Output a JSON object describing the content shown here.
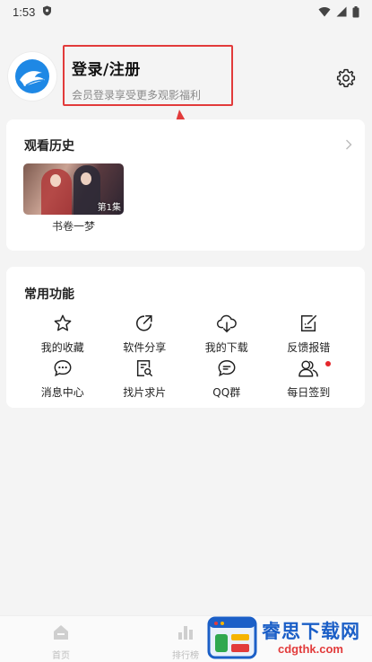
{
  "status_bar": {
    "time": "1:53"
  },
  "profile": {
    "login_title": "登录/注册",
    "login_subtitle": "会员登录享受更多观影福利"
  },
  "history": {
    "title": "观看历史",
    "items": [
      {
        "title": "书卷一梦",
        "episode_badge": "第1集"
      }
    ]
  },
  "functions": {
    "title": "常用功能",
    "items": [
      {
        "label": "我的收藏",
        "icon": "star-icon"
      },
      {
        "label": "软件分享",
        "icon": "share-icon"
      },
      {
        "label": "我的下载",
        "icon": "cloud-download-icon"
      },
      {
        "label": "反馈报错",
        "icon": "feedback-edit-icon"
      },
      {
        "label": "消息中心",
        "icon": "chat-bubble-icon"
      },
      {
        "label": "找片求片",
        "icon": "search-document-icon"
      },
      {
        "label": "QQ群",
        "icon": "chat-group-icon"
      },
      {
        "label": "每日签到",
        "icon": "users-checkin-icon",
        "badge": "red-dot"
      }
    ]
  },
  "bottom_nav": {
    "items": [
      {
        "label": "首页",
        "icon": "home-icon"
      },
      {
        "label": "排行榜",
        "icon": "bar-chart-icon"
      }
    ]
  },
  "watermark": {
    "text": "睿思下载网",
    "domain": "cdgthk.com"
  },
  "colors": {
    "highlight_border": "#e23b3b",
    "background": "#f4f4f4",
    "card": "#ffffff",
    "brand_blue": "#1e88e5"
  }
}
